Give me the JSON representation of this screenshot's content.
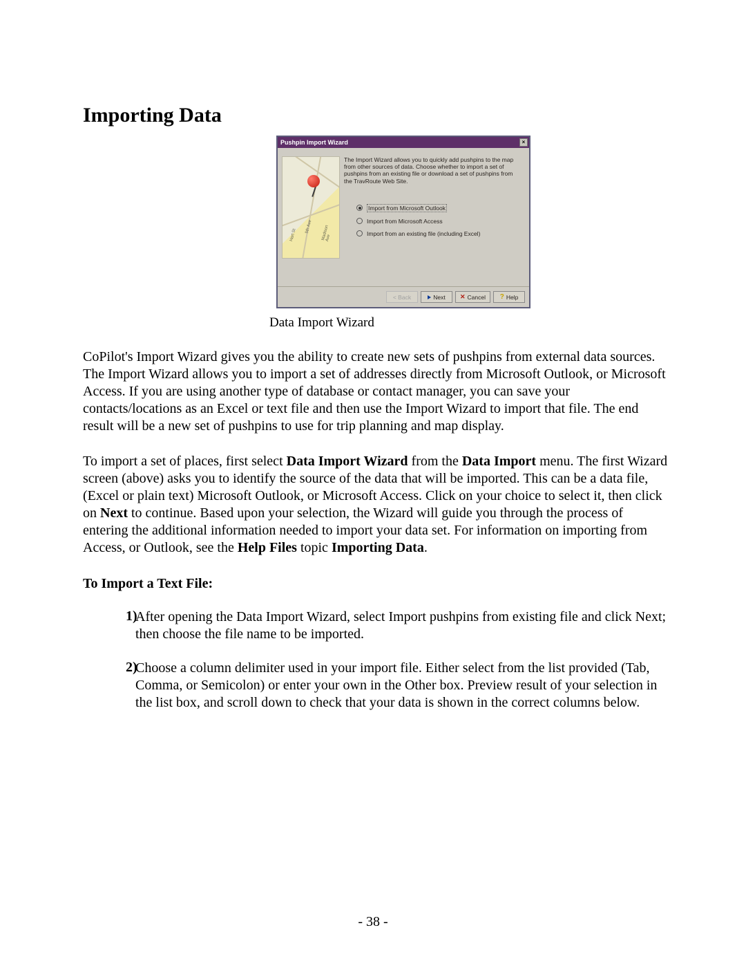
{
  "page": {
    "title": "Importing Data",
    "caption": "Data Import Wizard",
    "page_number": "- 38 -"
  },
  "wizard": {
    "title": "Pushpin Import Wizard",
    "description": "The Import Wizard allows you to quickly add pushpins to the map from other sources of data. Choose whether to import a set of pushpins from an existing file or download a set of pushpins from the TravRoute Web Site.",
    "options": [
      "Import from Microsoft Outlook",
      "Import from Microsoft Access",
      "Import from an existing file (including Excel)"
    ],
    "map_labels": {
      "a": "Hart St",
      "b": "5th Ave",
      "c": "Madison Ave"
    },
    "buttons": {
      "back": "< Back",
      "next": "Next",
      "cancel": "Cancel",
      "help": "Help"
    }
  },
  "body": {
    "para1_pre": "CoPilot's Import Wizard gives you the ability to create new sets of pushpins from external data sources.  The Import Wizard allows you to import a set of addresses directly from Microsoft Outlook, or Microsoft Access.  If you are using another type of database or contact manager, you can save your contacts/locations as an Excel or text file and then use the Import Wizard to import that file.  The end result will be a new set of pushpins to use for trip planning and map display.",
    "para2": {
      "a": "To import a set of places, first select ",
      "b": "Data Import Wizard",
      "c": " from the ",
      "d": "Data Import",
      "e": " menu.  The first Wizard screen (above) asks you to identify the source of the data that will be imported.  This can be a data file, (Excel or plain text) Microsoft Outlook, or Microsoft Access.  Click on your choice to select it, then click on ",
      "f": "Next",
      "g": " to continue.  Based upon your selection, the Wizard will guide you through the process of entering the additional information needed to import your data set.  For information on importing from Access, or Outlook, see the ",
      "h": "Help Files",
      "i": " topic ",
      "j": "Importing Data",
      "k": "."
    },
    "subhead": "To Import a Text File:",
    "steps": {
      "n1": "1)",
      "s1": {
        "a": "After opening the Data Import Wizard, select ",
        "b": "Import pushpins from existing file",
        "c": " and click ",
        "d": "Next",
        "e": "; then choose the file name to be imported."
      },
      "n2": "2)",
      "s2": {
        "a": "Choose a column delimiter used in your import file.  Either select from the list provided (",
        "b": "Tab",
        "c": ", ",
        "d": "Comma",
        "e": ", or ",
        "f": "Semicolon",
        "g": ") or enter your own in the ",
        "h": "Other",
        "i": " box.  Preview result of your selection in the list box, and scroll down to check that your data is shown in the correct columns below."
      }
    }
  }
}
